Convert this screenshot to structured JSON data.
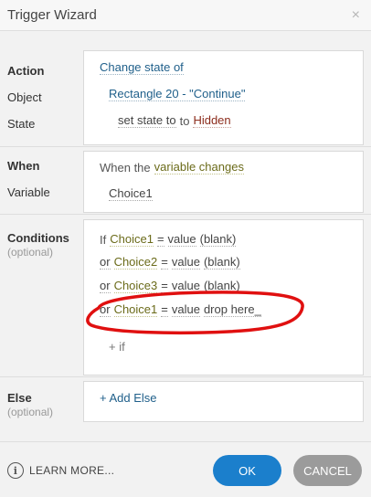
{
  "window": {
    "title": "Trigger Wizard",
    "close_glyph": "×"
  },
  "action": {
    "labels": {
      "action": "Action",
      "object": "Object",
      "state": "State"
    },
    "action_value": "Change state of",
    "object_value": "Rectangle 20 - \"Continue\"",
    "state_prefix": "set state to",
    "state_value": "Hidden"
  },
  "when": {
    "labels": {
      "when": "When",
      "variable": "Variable"
    },
    "prefix": "When the",
    "trigger": "variable changes",
    "variable_value": "Choice1"
  },
  "conditions": {
    "label": "Conditions",
    "optional": "(optional)",
    "rows": [
      {
        "conj": "If",
        "variable": "Choice1",
        "op": "=",
        "kind": "value",
        "target": "(blank)"
      },
      {
        "conj": "or",
        "variable": "Choice2",
        "op": "=",
        "kind": "value",
        "target": "(blank)"
      },
      {
        "conj": "or",
        "variable": "Choice3",
        "op": "=",
        "kind": "value",
        "target": "(blank)"
      },
      {
        "conj": "or",
        "variable": "Choice1",
        "op": "=",
        "kind": "value",
        "target": "drop here_"
      }
    ],
    "add_if": "+ if"
  },
  "else": {
    "label": "Else",
    "optional": "(optional)",
    "add": "+ Add Else"
  },
  "footer": {
    "learn_more": "LEARN MORE...",
    "ok": "OK",
    "cancel": "CANCEL",
    "info_glyph": "i"
  },
  "colors": {
    "ok": "#1b7fcc",
    "cancel": "#9b9b9b",
    "annotation": "#e01010"
  }
}
